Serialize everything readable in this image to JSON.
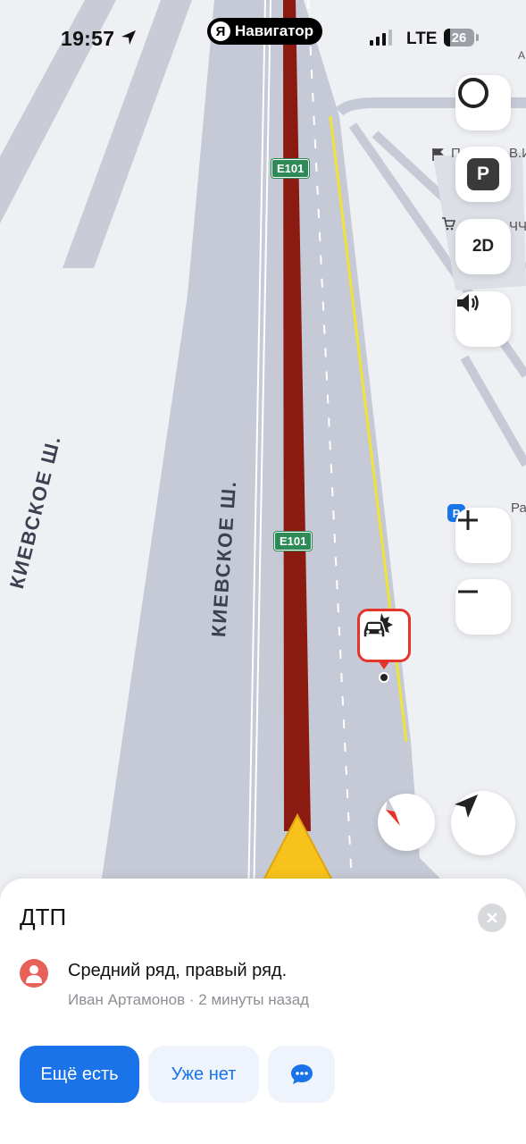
{
  "status_bar": {
    "time": "19:57",
    "app_pill_logo": "Я",
    "app_pill_label": "Навигатор",
    "network": "LTE",
    "battery": "26"
  },
  "map": {
    "road_number": "E101",
    "street_name": "КИЕВСКОЕ Ш.",
    "highway_marker": "M3",
    "parking_label": "P",
    "mode_label": "2D",
    "poi_labels": [
      "П",
      "В.И.",
      "ЧЧ",
      "Ра",
      "А"
    ],
    "colors": {
      "route": "#8b1a10",
      "road": "#c6cad6",
      "map_bg": "#eef0f3",
      "incident": "#e5352b",
      "road_sign": "#2e8b57",
      "yellow_line": "#f0e33a"
    }
  },
  "incident": {
    "title": "ДТП",
    "comment": "Средний ряд, правый ряд.",
    "author": "Иван Артамонов",
    "separator": "·",
    "time_ago": "2 минуты назад",
    "buttons": {
      "still_there": "Ещё есть",
      "gone": "Уже нет"
    },
    "colors": {
      "primary": "#1a73e8",
      "secondary_bg": "#eef3fc",
      "avatar": "#e8605a"
    }
  }
}
